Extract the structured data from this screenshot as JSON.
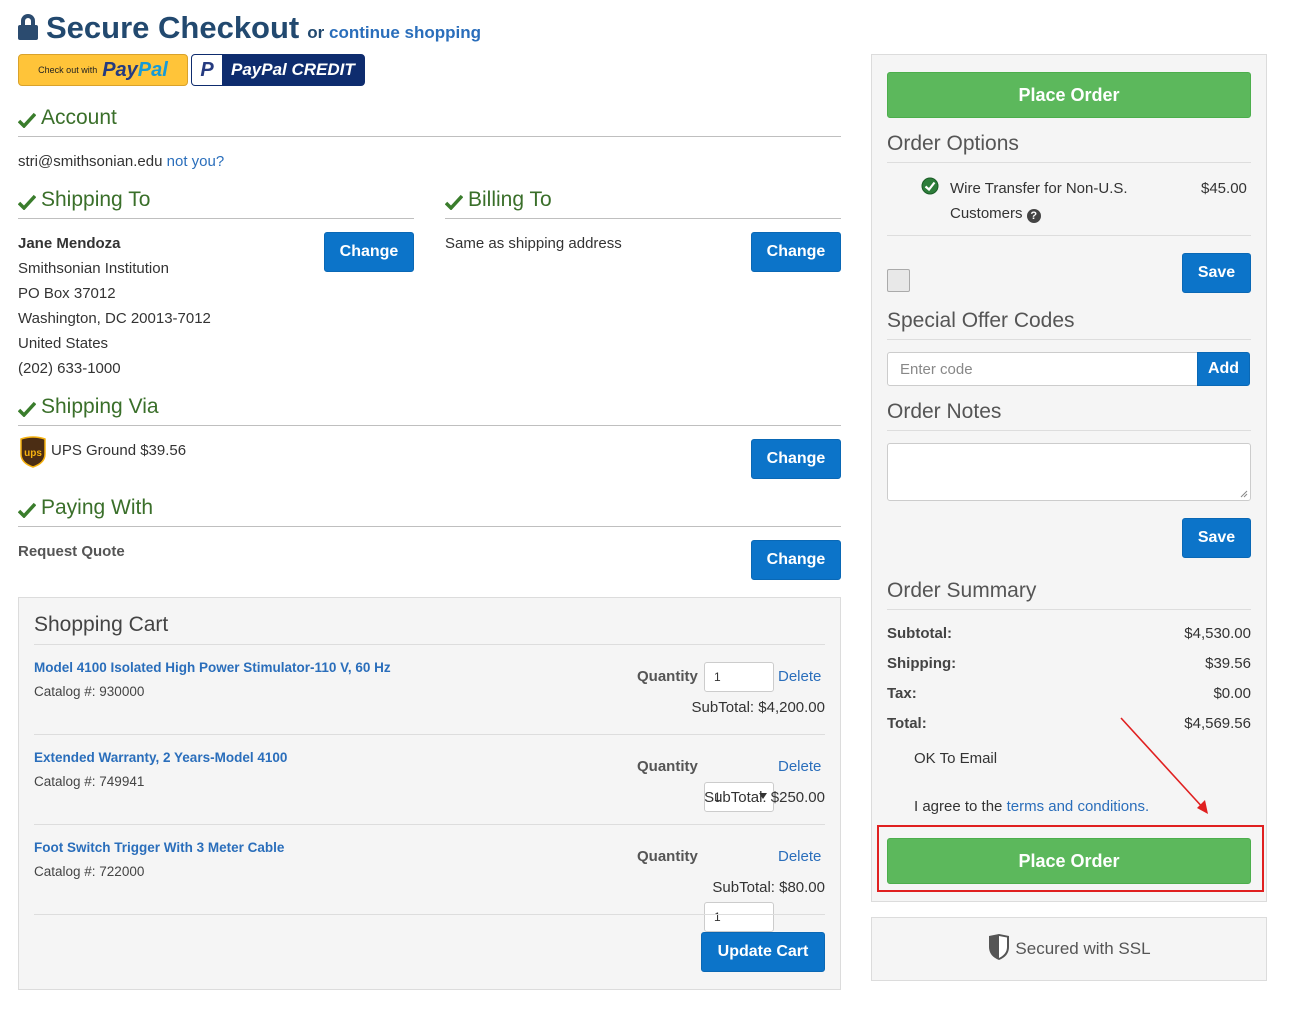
{
  "header": {
    "title": "Secure Checkout",
    "or_text": "or",
    "continue_link": "continue shopping"
  },
  "paypal": {
    "checkout_small": "Check out with",
    "pay": "Pay",
    "pal": "Pal",
    "credit_p": "P",
    "credit_label": "PayPal CREDIT"
  },
  "account": {
    "heading": "Account",
    "email": "stri@smithsonian.edu",
    "not_you": "not you?"
  },
  "shipping_to": {
    "heading": "Shipping To",
    "name": "Jane Mendoza",
    "org": "Smithsonian Institution",
    "street": "PO Box 37012",
    "city": "Washington, DC 20013-7012",
    "country": "United States",
    "phone": "(202) 633-1000",
    "change": "Change"
  },
  "billing_to": {
    "heading": "Billing To",
    "text": "Same as shipping address",
    "change": "Change"
  },
  "shipping_via": {
    "heading": "Shipping Via",
    "ups_logo": "ups",
    "method": "UPS Ground $39.56",
    "change": "Change"
  },
  "paying_with": {
    "heading": "Paying With",
    "method": "Request Quote",
    "change": "Change"
  },
  "cart": {
    "title": "Shopping Cart",
    "quantity_label": "Quantity",
    "delete_label": "Delete",
    "items": [
      {
        "name": "Model 4100 Isolated High Power Stimulator-110 V, 60 Hz",
        "catalog": "Catalog #: 930000",
        "qty": "1",
        "subtotal": "SubTotal: $4,200.00"
      },
      {
        "name": "Extended Warranty, 2 Years-Model 4100",
        "catalog": "Catalog #: 749941",
        "qty": "1",
        "subtotal": "SubTotal: $250.00"
      },
      {
        "name": "Foot Switch Trigger With 3 Meter Cable",
        "catalog": "Catalog #: 722000",
        "qty": "1",
        "subtotal": "SubTotal: $80.00"
      }
    ],
    "update": "Update Cart"
  },
  "right": {
    "place_order": "Place Order",
    "order_options": {
      "heading": "Order Options",
      "wire_line1": "Wire Transfer for Non-U.S.",
      "wire_line2": "Customers",
      "price": "$45.00",
      "save": "Save"
    },
    "offer": {
      "heading": "Special Offer Codes",
      "placeholder": "Enter code",
      "add": "Add"
    },
    "notes": {
      "heading": "Order Notes",
      "save": "Save"
    },
    "summary": {
      "heading": "Order Summary",
      "rows": [
        {
          "label": "Subtotal:",
          "value": "$4,530.00"
        },
        {
          "label": "Shipping:",
          "value": "$39.56"
        },
        {
          "label": "Tax:",
          "value": "$0.00"
        },
        {
          "label": "Total:",
          "value": "$4,569.56"
        }
      ],
      "ok_email": "OK To Email",
      "agree_prefix": "I agree to the",
      "terms": "terms and conditions",
      "agree_suffix": "."
    },
    "ssl": "Secured with SSL"
  },
  "colors": {
    "green_button": "#5cb85c",
    "blue_button": "#0c74c9",
    "annotation_red": "#e02020"
  }
}
